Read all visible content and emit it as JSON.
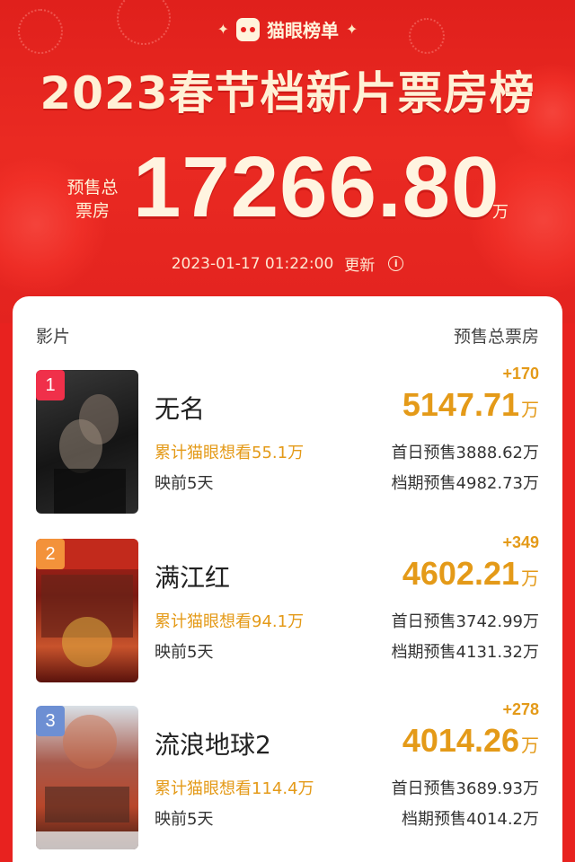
{
  "brand": {
    "name": "猫眼榜单"
  },
  "title": "2023春节档新片票房榜",
  "total": {
    "label": "预售总票房",
    "value": "17266.80",
    "unit": "万"
  },
  "update": {
    "time": "2023-01-17  01:22:00",
    "label": "更新"
  },
  "table": {
    "col_movie": "影片",
    "col_presale": "预售总票房"
  },
  "movies": [
    {
      "rank": "1",
      "name": "无名",
      "delta": "+170",
      "box": "5147.71",
      "unit": "万",
      "want": "累计猫眼想看55.1万",
      "first_day": "首日预售3888.62万",
      "days": "映前5天",
      "period": "档期预售4982.73万"
    },
    {
      "rank": "2",
      "name": "满江红",
      "delta": "+349",
      "box": "4602.21",
      "unit": "万",
      "want": "累计猫眼想看94.1万",
      "first_day": "首日预售3742.99万",
      "days": "映前5天",
      "period": "档期预售4131.32万"
    },
    {
      "rank": "3",
      "name": "流浪地球2",
      "delta": "+278",
      "box": "4014.26",
      "unit": "万",
      "want": "累计猫眼想看114.4万",
      "first_day": "首日预售3689.93万",
      "days": "映前5天",
      "period": "档期预售4014.2万"
    }
  ],
  "colors": {
    "hero_red": "#e8221f",
    "gold_text": "#e49a18",
    "rank_1": "#f0304a",
    "rank_2": "#f3923a",
    "rank_3": "#6d8fd3"
  }
}
